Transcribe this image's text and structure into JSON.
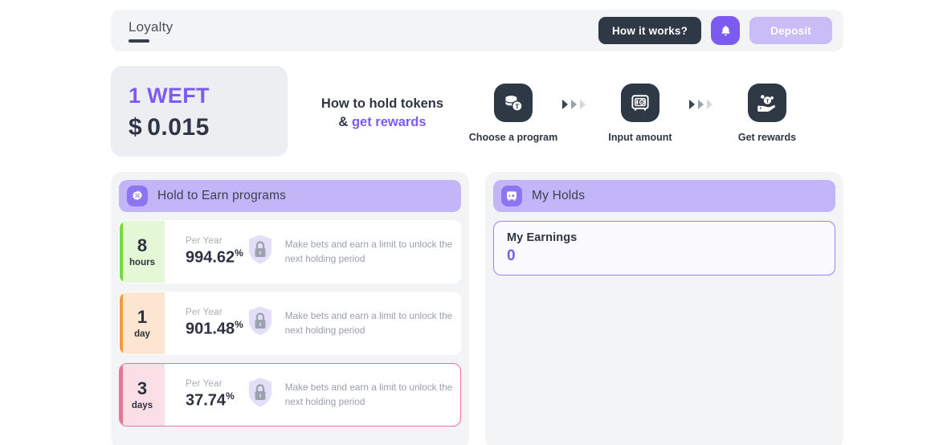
{
  "header": {
    "tab_label": "Loyalty",
    "how_it_works_label": "How it works?",
    "bell_icon": "bell-icon",
    "deposit_label": "Deposit"
  },
  "price": {
    "token_amount": "1 WEFT",
    "currency_symbol": "$",
    "usd_value": "0.015"
  },
  "steps": {
    "title_line1": "How to hold tokens",
    "title_amp": "&",
    "title_accent": "get rewards",
    "items": [
      {
        "label": "Choose a program",
        "icon": "coin-stack-token-icon"
      },
      {
        "label": "Input amount",
        "icon": "safe-vault-icon"
      },
      {
        "label": "Get rewards",
        "icon": "hand-receiving-token-icon"
      }
    ],
    "arrow_icon": "chevrons-right-icon"
  },
  "hold_to_earn": {
    "title": "Hold to Earn programs",
    "icon": "percent-badge-icon",
    "programs": [
      {
        "number": "8",
        "unit": "hours",
        "color_class": "p-green",
        "accent": "#7ada3a",
        "apy_label": "Per Year",
        "apy_value": "994.62",
        "apy_suffix": "%",
        "lock_icon": "lock-shield-icon",
        "description": "Make bets and earn a limit to unlock the next holding period",
        "selected": false
      },
      {
        "number": "1",
        "unit": "day",
        "color_class": "p-orange",
        "accent": "#f7993f",
        "apy_label": "Per Year",
        "apy_value": "901.48",
        "apy_suffix": "%",
        "lock_icon": "lock-shield-icon",
        "description": "Make bets and earn a limit to unlock the next holding period",
        "selected": false
      },
      {
        "number": "3",
        "unit": "days",
        "color_class": "p-pink",
        "accent": "#e8739c",
        "apy_label": "Per Year",
        "apy_value": "37.74",
        "apy_suffix": "%",
        "lock_icon": "lock-shield-icon",
        "description": "Make bets and earn a limit to unlock the next holding period",
        "selected": true
      }
    ]
  },
  "my_holds": {
    "title": "My Holds",
    "icon": "safe-vault-icon",
    "earnings_title": "My Earnings",
    "earnings_value": "0"
  },
  "colors": {
    "accent_purple": "#7c5cf0",
    "dark": "#2f3845",
    "panel_bg": "#f2f4f6",
    "header_purple": "#c3b6f8",
    "selected_pink": "#e8739c"
  }
}
